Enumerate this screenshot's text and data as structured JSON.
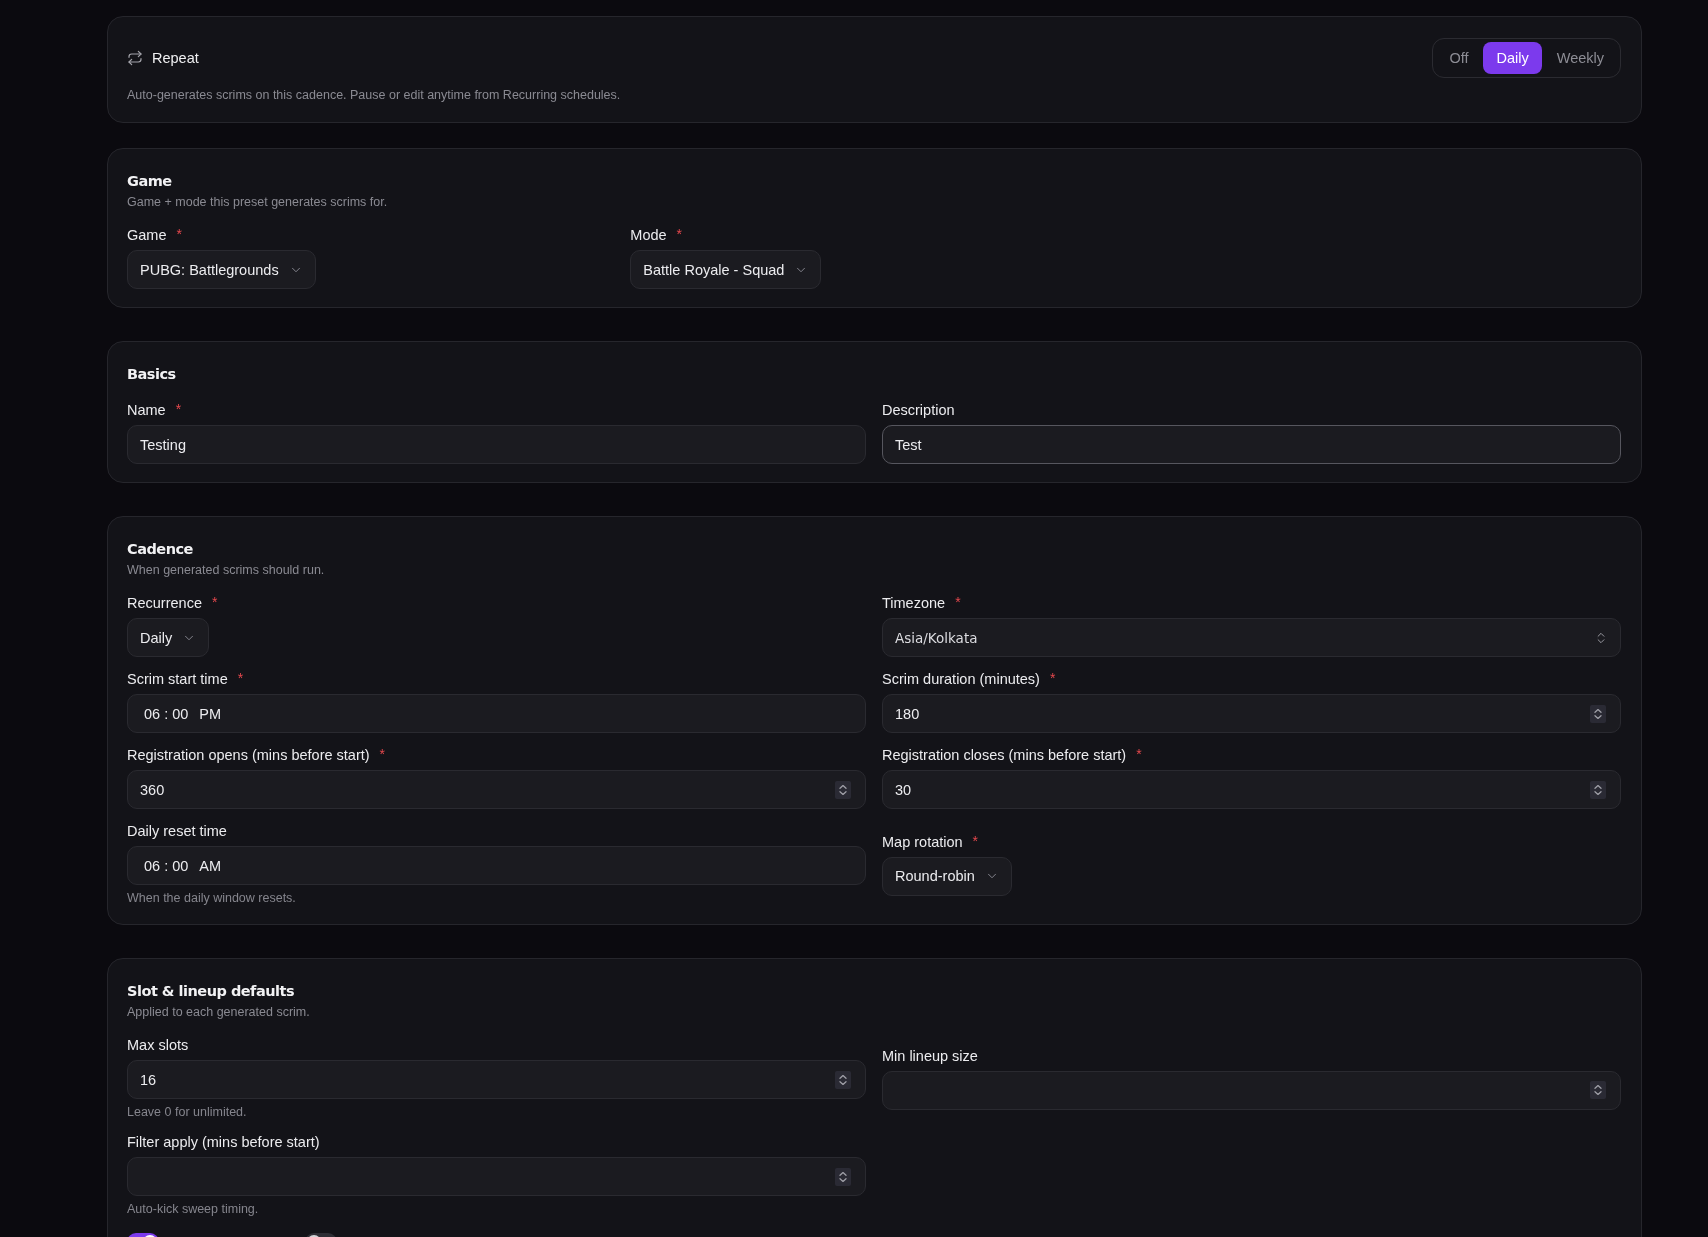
{
  "repeat": {
    "title": "Repeat",
    "description": "Auto-generates scrims on this cadence. Pause or edit anytime from Recurring schedules.",
    "options": [
      {
        "label": "Off",
        "selected": false
      },
      {
        "label": "Daily",
        "selected": true
      },
      {
        "label": "Weekly",
        "selected": false
      }
    ]
  },
  "game": {
    "title": "Game",
    "subtitle": "Game + mode this preset generates scrims for.",
    "rows": [
      [
        {
          "label": "Game",
          "marker": "*",
          "kind": "select",
          "value": "PUBG: Battlegrounds"
        },
        {
          "label": "Mode",
          "marker": "*",
          "kind": "select",
          "value": "Battle Royale - Squad"
        }
      ]
    ]
  },
  "basics": {
    "title": "Basics",
    "rows": [
      [
        {
          "label": "Name",
          "marker": "*",
          "kind": "text",
          "value": "Testing",
          "focused": false
        },
        {
          "label": "Description",
          "kind": "text",
          "value": "Test",
          "focused": true
        }
      ]
    ]
  },
  "cadence": {
    "title": "Cadence",
    "subtitle": "When generated scrims should run.",
    "rows": [
      [
        {
          "label": "Recurrence",
          "marker": "*",
          "kind": "select",
          "value": "Daily"
        },
        {
          "label": "Timezone",
          "marker": "*",
          "kind": "combobox",
          "value": "Asia/Kolkata"
        }
      ],
      [
        {
          "label": "Scrim start time",
          "marker": "*",
          "kind": "time",
          "time": {
            "hour": "06",
            "separator": ":",
            "minute": "00",
            "period": "PM"
          }
        },
        {
          "label": "Scrim duration (minutes)",
          "marker": "*",
          "kind": "number",
          "value": "180"
        }
      ],
      [
        {
          "label": "Registration opens (mins before start)",
          "marker": "*",
          "kind": "number",
          "value": "360"
        },
        {
          "label": "Registration closes (mins before start)",
          "marker": "*",
          "kind": "number",
          "value": "30"
        }
      ],
      [
        {
          "label": "Daily reset time",
          "kind": "time",
          "time": {
            "hour": "06",
            "separator": ":",
            "minute": "00",
            "period": "AM"
          },
          "hint": "When the daily window resets."
        },
        {
          "label": "Map rotation",
          "marker": "*",
          "kind": "select",
          "value": "Round-robin"
        }
      ]
    ]
  },
  "slot_defaults": {
    "title": "Slot & lineup defaults",
    "subtitle": "Applied to each generated scrim.",
    "rows": [
      [
        {
          "label": "Max slots",
          "kind": "number",
          "value": "16",
          "hint": "Leave 0 for unlimited."
        },
        {
          "label": "Min lineup size",
          "kind": "number"
        }
      ],
      [
        {
          "label": "Filter apply (mins before start)",
          "kind": "number",
          "hint": "Auto-kick sweep timing."
        }
      ]
    ],
    "toggles": [
      {
        "on": true
      },
      {
        "on": false
      }
    ]
  }
}
